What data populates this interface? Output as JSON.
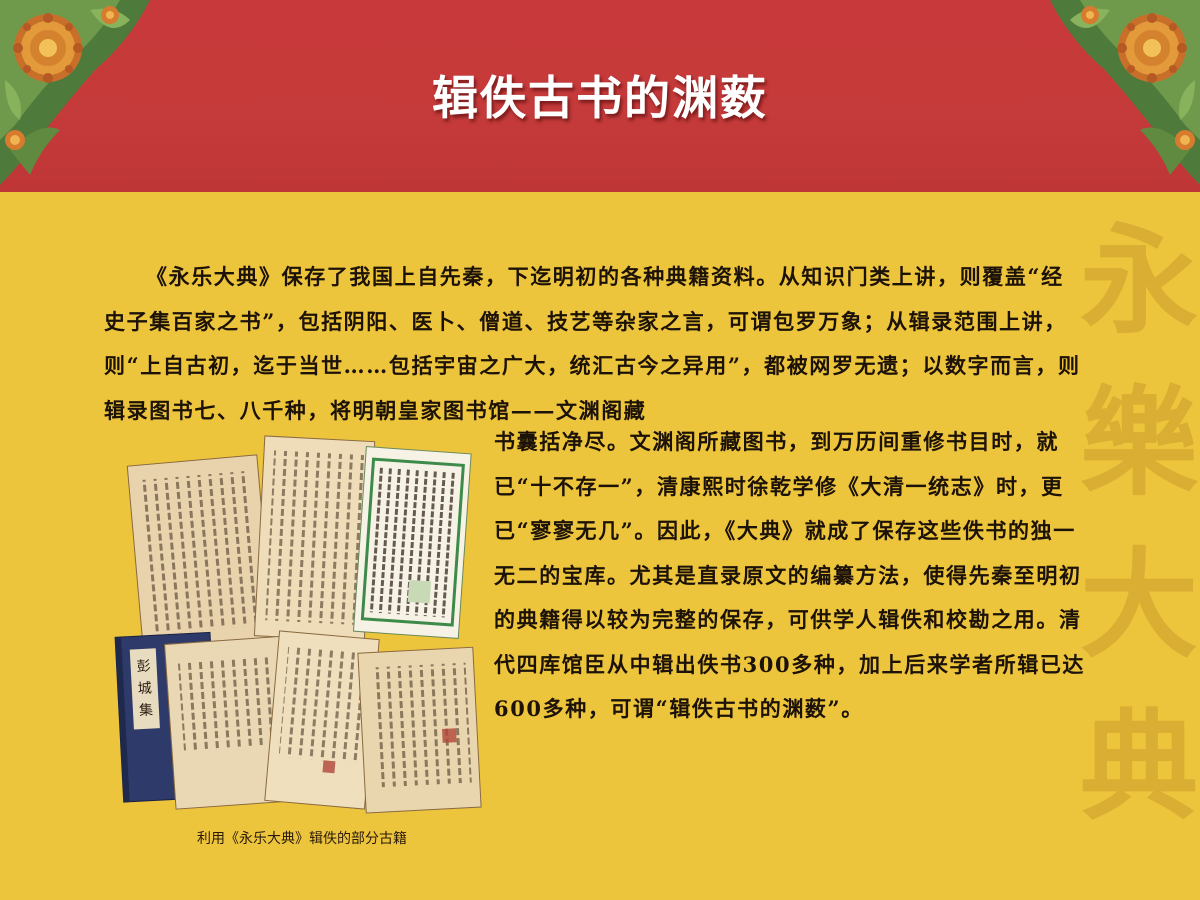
{
  "header": {
    "title": "辑佚古书的渊薮"
  },
  "watermark": {
    "chars": [
      "永",
      "樂",
      "大",
      "典"
    ]
  },
  "article": {
    "para_top": "《永乐大典》保存了我国上自先秦，下迄明初的各种典籍资料。从知识门类上讲，则覆盖“经史子集百家之书”，包括阴阳、医卜、僧道、技艺等杂家之言，可谓包罗万象；从辑录范围上讲，则“上自古初，迄于当世……包括宇宙之广大，统汇古今之异用”，都被网罗无遗；以数字而言，则辑录图书七、八千种，将明朝皇家图书馆——文渊阁藏",
    "para_right": "书囊括净尽。文渊阁所藏图书，到万历间重修书目时，就已“十不存一”，清康熙时徐乾学修《大清一统志》时，更已“寥寥无几”。因此，《大典》就成了保存这些佚书的独一无二的宝库。尤其是直录原文的编纂方法，使得先秦至明初的典籍得以较为完整的保存，可供学人辑佚和校勘之用。清代四库馆臣从中辑出佚书300多种，加上后来学者所辑已达600多种，可谓“辑佚古书的渊薮”。"
  },
  "figure": {
    "book_cover_title": "彭城集",
    "caption": "利用《永乐大典》辑佚的部分古籍"
  },
  "colors": {
    "header_red": "#c53a3a",
    "background_yellow": "#edc53c",
    "watermark": "#d9ae32",
    "text": "#1d1208"
  }
}
